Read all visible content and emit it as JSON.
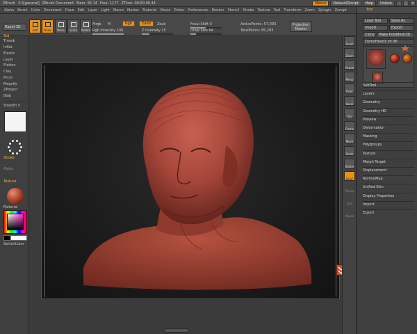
{
  "titlebar": {
    "app": "ZBrush",
    "version": "3.0[general]",
    "doc": "ZBrush Document",
    "mem": "Mem: 95.14",
    "free": "Free: 1177",
    "ztime": "ZTime: 00:00:00.44",
    "menus_btn": "Menus",
    "script_btn": "DefaultZScript",
    "help_btn": "Help",
    "unlock_btn": "Unlock"
  },
  "menubar": [
    "Alpha",
    "Brush",
    "Color",
    "Document",
    "Draw",
    "Edit",
    "Layer",
    "Light",
    "Macro",
    "Marker",
    "Material",
    "Movie",
    "Picker",
    "Preferences",
    "Render",
    "Stencil",
    "Stroke",
    "Texture",
    "Tool",
    "Transform",
    "Zoom",
    "Zplugin",
    "Zscript"
  ],
  "shelf": {
    "rapid": "Rapid 3D",
    "edit": "Edit",
    "draw": "Draw",
    "move": "Move",
    "scale": "Scale",
    "rotate": "Rotate",
    "mrgb": "Mrgb",
    "m": "M",
    "rgb": "Rgb",
    "zadd": "Zadd",
    "zsub": "Zsub",
    "rgb_intensity": "Rgb Intensity 100",
    "z_intensity": "Z Intensity 25",
    "focal_shift": "Focal Shift 0",
    "draw_size": "Draw Size 64",
    "active_points": "ActivePoints: 57,093",
    "total_points": "TotalPoints: 85,283",
    "projection_master": "Projection Master"
  },
  "lefttray": {
    "items": [
      "Std",
      "Tmask",
      "Inflat",
      "Elastic",
      "Layer",
      "Flatten",
      "Clay",
      "Pinch",
      "Magnify",
      "ZProject",
      "Blob"
    ],
    "smooth": "Smooth 5",
    "stroke_label": "Stroke",
    "alpha_label": "Alpha",
    "texture_label": "Texture",
    "material_label": "Material",
    "switch_color": "SwitchColor"
  },
  "rdock": [
    "Scroll",
    "Zoom",
    "Actual",
    "Persp",
    "Floor",
    "Local",
    "Xyz",
    "Frame",
    "Move",
    "Scale",
    "Rotate",
    "PolyF",
    "Transp",
    "Solo",
    "Xpose"
  ],
  "rpanel": {
    "title": "Tool",
    "load_tool": "Load Tool",
    "save_as": "Save As",
    "import": "Import",
    "export": "Export",
    "clone": "Clone",
    "make_polymesh": "Make PolyMesh3D",
    "current_tool": "DemoHead3.ztl 06",
    "sections": [
      "SubTool",
      "Layers",
      "Geometry",
      "Geometry HD",
      "Preview",
      "Deformation",
      "Masking",
      "Polygroups",
      "Texture",
      "Morph Target",
      "Displacement",
      "NormalMap",
      "Unified Skin",
      "Display Properties",
      "Import",
      "Export"
    ]
  },
  "colors": {
    "accent": "#e8901e",
    "model_skin": "#a5463a",
    "section_text": "#d8d8d8"
  }
}
